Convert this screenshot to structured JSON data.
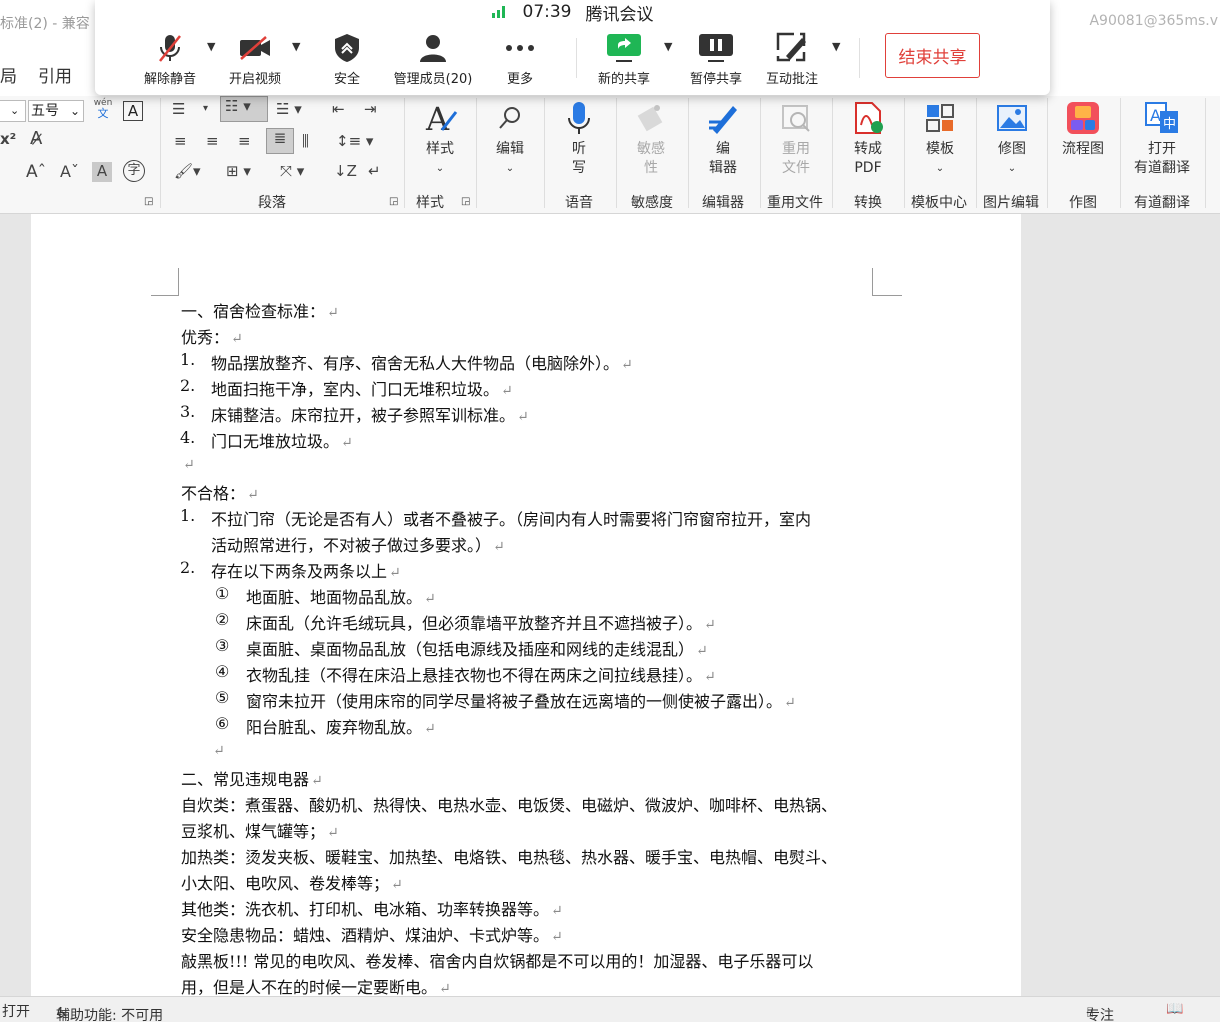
{
  "window": {
    "doc_title": "标准(2)  -  兼容",
    "account": "A90081@365ms.v"
  },
  "menu": {
    "items": [
      "局",
      "引用"
    ]
  },
  "meeting": {
    "time": "07:39",
    "app_name": "腾讯会议",
    "buttons": {
      "unmute": "解除静音",
      "video": "开启视频",
      "security": "安全",
      "members": "管理成员(20)",
      "more": "更多",
      "new_share": "新的共享",
      "pause_share": "暂停共享",
      "annotate": "互动批注"
    },
    "end_share": "结束共享",
    "colors": {
      "green": "#1fb655",
      "red": "#e0403a"
    }
  },
  "ribbon": {
    "font_size": "五号",
    "phonetic_top": "wén",
    "phonetic_bottom": "文",
    "groups": {
      "paragraph": "段落",
      "style": "样式",
      "voice": "语音",
      "sensitivity": "敏感度",
      "editor": "编辑器",
      "reuse": "重用文件",
      "convert": "转换",
      "template_center": "模板中心",
      "image_edit": "图片编辑",
      "draw": "作图",
      "youdao": "有道翻译"
    },
    "buttons": {
      "style": "样式",
      "edit": "编辑",
      "dictate": "听\n写",
      "sensitivity": "敏感\n性",
      "editor": "编\n辑器",
      "reuse": "重用\n文件",
      "to_pdf": "转成\nPDF",
      "template": "模板",
      "retouch": "修图",
      "flowchart": "流程图",
      "open_youdao": "打开\n有道翻译"
    }
  },
  "document": {
    "s1_title": "一、宿舍检查标准：",
    "excellent_label": "优秀：",
    "excellent": [
      {
        "n": "1.",
        "t": "物品摆放整齐、有序、宿舍无私人大件物品（电脑除外）。"
      },
      {
        "n": "2.",
        "t": "地面扫拖干净，室内、门口无堆积垃圾。"
      },
      {
        "n": "3.",
        "t": "床铺整洁。床帘拉开，被子参照军训标准。"
      },
      {
        "n": "4.",
        "t": "门口无堆放垃圾。"
      }
    ],
    "fail_label": "不合格：",
    "fail_1_n": "1.",
    "fail_1_a": "不拉门帘（无论是否有人）或者不叠被子。（房间内有人时需要将门帘窗帘拉开，室内",
    "fail_1_b": "活动照常进行，不对被子做过多要求。）",
    "fail_2_n": "2.",
    "fail_2": "存在以下两条及两条以上",
    "sub": [
      {
        "n": "①",
        "t": "地面脏、地面物品乱放。"
      },
      {
        "n": "②",
        "t": "床面乱（允许毛绒玩具，但必须靠墙平放整齐并且不遮挡被子）。"
      },
      {
        "n": "③",
        "t": "桌面脏、桌面物品乱放（包括电源线及插座和网线的走线混乱）"
      },
      {
        "n": "④",
        "t": "衣物乱挂（不得在床沿上悬挂衣物也不得在两床之间拉线悬挂）。"
      },
      {
        "n": "⑤",
        "t": "窗帘未拉开（使用床帘的同学尽量将被子叠放在远离墙的一侧使被子露出）。"
      },
      {
        "n": "⑥",
        "t": "阳台脏乱、废弃物乱放。"
      }
    ],
    "s2_title": "二、常见违规电器",
    "cook_a": "自炊类：煮蛋器、酸奶机、热得快、电热水壶、电饭煲、电磁炉、微波炉、咖啡杯、电热锅、",
    "cook_b": "豆浆机、煤气罐等；",
    "heat_a": "加热类：烫发夹板、暖鞋宝、加热垫、电烙铁、电热毯、热水器、暖手宝、电热帽、电熨斗、",
    "heat_b": "小太阳、电吹风、卷发棒等；",
    "other": "其他类：洗衣机、打印机、电冰箱、功率转换器等。",
    "danger": "安全隐患物品：蜡烛、酒精炉、煤油炉、卡式炉等。",
    "warn_a": "敲黑板!!! 常见的电吹风、卷发棒、宿舍内自炊锅都是不可以用的！加湿器、电子乐器可以",
    "warn_b": "用，但是人不在的时候一定要断电。",
    "para_mark": "↵"
  },
  "status": {
    "left": "打开",
    "accessibility": "辅助功能: 不可用",
    "focus": "专注"
  }
}
